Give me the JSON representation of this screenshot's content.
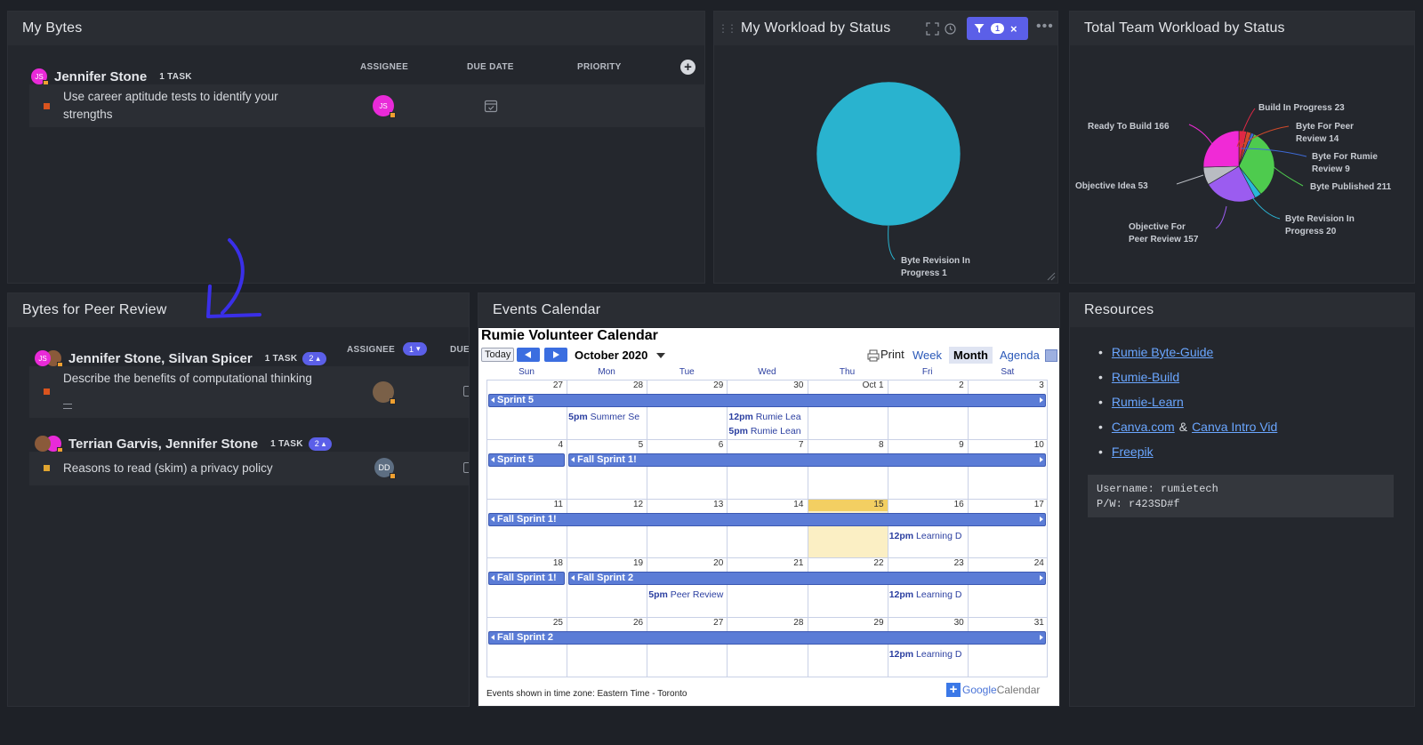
{
  "my_bytes": {
    "title": "My Bytes",
    "assignee_name": "Jennifer Stone",
    "task_count": "1 TASK",
    "avatar_initials": "JS",
    "col_assignee": "ASSIGNEE",
    "col_due_date": "DUE DATE",
    "col_priority": "PRIORITY",
    "task": "Use career aptitude tests to identify your strengths",
    "task_status_color": "#d9541e"
  },
  "workload_status": {
    "title": "My Workload by Status",
    "filter_count": "1",
    "chart_data": {
      "type": "pie",
      "title": "",
      "slices": [
        {
          "label": "Byte Revision In Progress 1",
          "value": 1,
          "color": "#29b3cf"
        }
      ]
    }
  },
  "team_workload": {
    "title": "Total Team Workload by Status",
    "chart_data": {
      "type": "pie",
      "title": "",
      "slices": [
        {
          "label": "Build In Progress",
          "value": 23,
          "color": "#e02845"
        },
        {
          "label": "Byte For Peer Review",
          "value": 14,
          "color": "#d24a2a"
        },
        {
          "label": "Byte For Rumie Review",
          "value": 9,
          "color": "#3e6ad6"
        },
        {
          "label": "Byte Published",
          "value": 211,
          "color": "#4ecb4e"
        },
        {
          "label": "Byte Revision In Progress",
          "value": 20,
          "color": "#2ab8d8"
        },
        {
          "label": "Objective For Peer Review",
          "value": 157,
          "color": "#9b5cf0"
        },
        {
          "label": "Objective Idea",
          "value": 53,
          "color": "#b9bcc2"
        },
        {
          "label": "Ready To Build",
          "value": 166,
          "color": "#f02ad6"
        }
      ],
      "labels_text": {
        "build_in_progress": "Build In Progress 23",
        "byte_for_peer_1": "Byte For Peer",
        "byte_for_peer_2": "Review 14",
        "byte_for_rumie_1": "Byte For Rumie",
        "byte_for_rumie_2": "Review 9",
        "byte_published": "Byte Published 211",
        "byte_revision_1": "Byte Revision In",
        "byte_revision_2": "Progress 20",
        "objective_peer_1": "Objective For",
        "objective_peer_2": "Peer Review 157",
        "objective_idea": "Objective Idea 53",
        "ready_to_build": "Ready To Build 166"
      }
    }
  },
  "peer_review": {
    "title": "Bytes for Peer Review",
    "groups": [
      {
        "names": "Jennifer Stone, Silvan Spicer",
        "task_count": "1 TASK",
        "assignee_pill": "2",
        "task": "Describe the benefits of computational thinking",
        "task_color": "#d9541e"
      },
      {
        "names": "Terrian Garvis, Jennifer Stone",
        "task_count": "1 TASK",
        "assignee_pill": "2",
        "task": "Reasons to read (skim) a privacy policy",
        "task_color": "#e0a530",
        "avatar_initials": "DD"
      }
    ],
    "col_assignee": "ASSIGNEE",
    "col_assignee_pill": "1",
    "col_due": "DUE"
  },
  "events_calendar": {
    "title": "Events Calendar",
    "cal_title": "Rumie Volunteer Calendar",
    "today_btn": "Today",
    "month_label": "October 2020",
    "print_label": "Print",
    "views": [
      "Week",
      "Month",
      "Agenda"
    ],
    "days_of_week": [
      "Sun",
      "Mon",
      "Tue",
      "Wed",
      "Thu",
      "Fri",
      "Sat"
    ],
    "weeks": [
      [
        "27",
        "28",
        "29",
        "30",
        "Oct 1",
        "2",
        "3"
      ],
      [
        "4",
        "5",
        "6",
        "7",
        "8",
        "9",
        "10"
      ],
      [
        "11",
        "12",
        "13",
        "14",
        "15",
        "16",
        "17"
      ],
      [
        "18",
        "19",
        "20",
        "21",
        "22",
        "23",
        "24"
      ],
      [
        "25",
        "26",
        "27",
        "28",
        "29",
        "30",
        "31"
      ]
    ],
    "bars": {
      "w0": "Sprint 5",
      "w1a": "Sprint 5",
      "w1b": "Fall Sprint 1!",
      "w2": "Fall Sprint 1!",
      "w3a": "Fall Sprint 1!",
      "w3b": "Fall Sprint 2",
      "w4": "Fall Sprint 2"
    },
    "events": {
      "e1_time": "5pm",
      "e1_title": "Summer Se",
      "e2_time": "12pm",
      "e2_title": "Rumie Lea",
      "e3_time": "5pm",
      "e3_title": "Rumie Lean",
      "e4_time": "12pm",
      "e4_title": "Learning D",
      "e5_time": "5pm",
      "e5_title": "Peer Review",
      "e6_time": "12pm",
      "e6_title": "Learning D",
      "e7_time": "12pm",
      "e7_title": "Learning D"
    },
    "timezone_note": "Events shown in time zone: Eastern Time - Toronto",
    "google_label": "Google",
    "calendar_label": "Calendar"
  },
  "resources": {
    "title": "Resources",
    "links": [
      {
        "text": "Rumie Byte-Guide"
      },
      {
        "text": "Rumie-Build "
      },
      {
        "text": "Rumie-Learn"
      },
      {
        "text": "Canva.com",
        "and": "&",
        "text2": "Canva Intro Vid"
      },
      {
        "text": "Freepik"
      }
    ],
    "username_line": "Username: rumietech",
    "password_line": "P/W: r423SD#f"
  },
  "colors": {
    "accent": "#5b5fe8",
    "link": "#6aa6ff",
    "annotation_arrow": "#3a2fe8"
  }
}
